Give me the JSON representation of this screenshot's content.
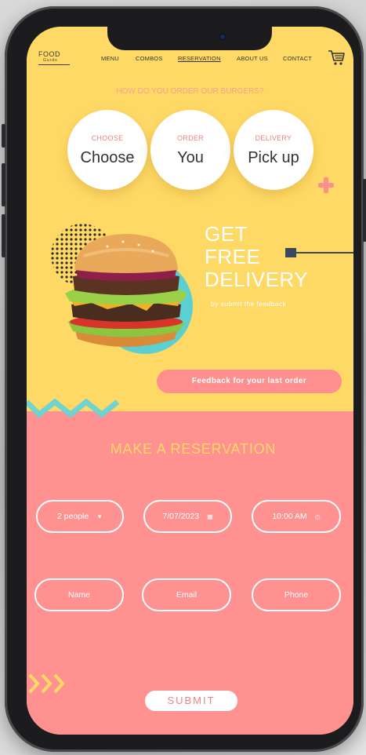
{
  "brand": {
    "name": "FOOD",
    "tagline": "Gurds"
  },
  "nav": {
    "items": [
      "MENU",
      "COMBOS",
      "RESERVATION",
      "ABOUT US",
      "CONTACT"
    ],
    "active": "RESERVATION"
  },
  "icons": {
    "cart": "cart-icon",
    "plus": "plus-icon",
    "dropdown": "caret-down-icon",
    "calendar": "calendar-icon",
    "clock": "clock-icon"
  },
  "order_question": "HOW DO YOU ORDER OUR BURGERS?",
  "order_steps": [
    {
      "label": "CHOOSE",
      "value": "Choose"
    },
    {
      "label": "ORDER",
      "value": "You"
    },
    {
      "label": "DELIVERY",
      "value": "Pick up"
    }
  ],
  "promo": {
    "line1": "GET",
    "line2": "FREE",
    "line3": "DELIVERY",
    "subtitle": "by submit the feedback"
  },
  "feedback_button": "Feedback for your last order",
  "reservation": {
    "title": "MAKE A RESERVATION",
    "people": "2 people",
    "date": "7/07/2023",
    "time": "10:00 AM",
    "name_placeholder": "Name",
    "email_placeholder": "Email",
    "phone_placeholder": "Phone",
    "submit_label": "SUBMIT"
  },
  "colors": {
    "yellow": "#ffd966",
    "salmon": "#ff9191",
    "pink_button": "#ff8f8f",
    "teal": "#5ccfd0",
    "white": "#ffffff"
  }
}
